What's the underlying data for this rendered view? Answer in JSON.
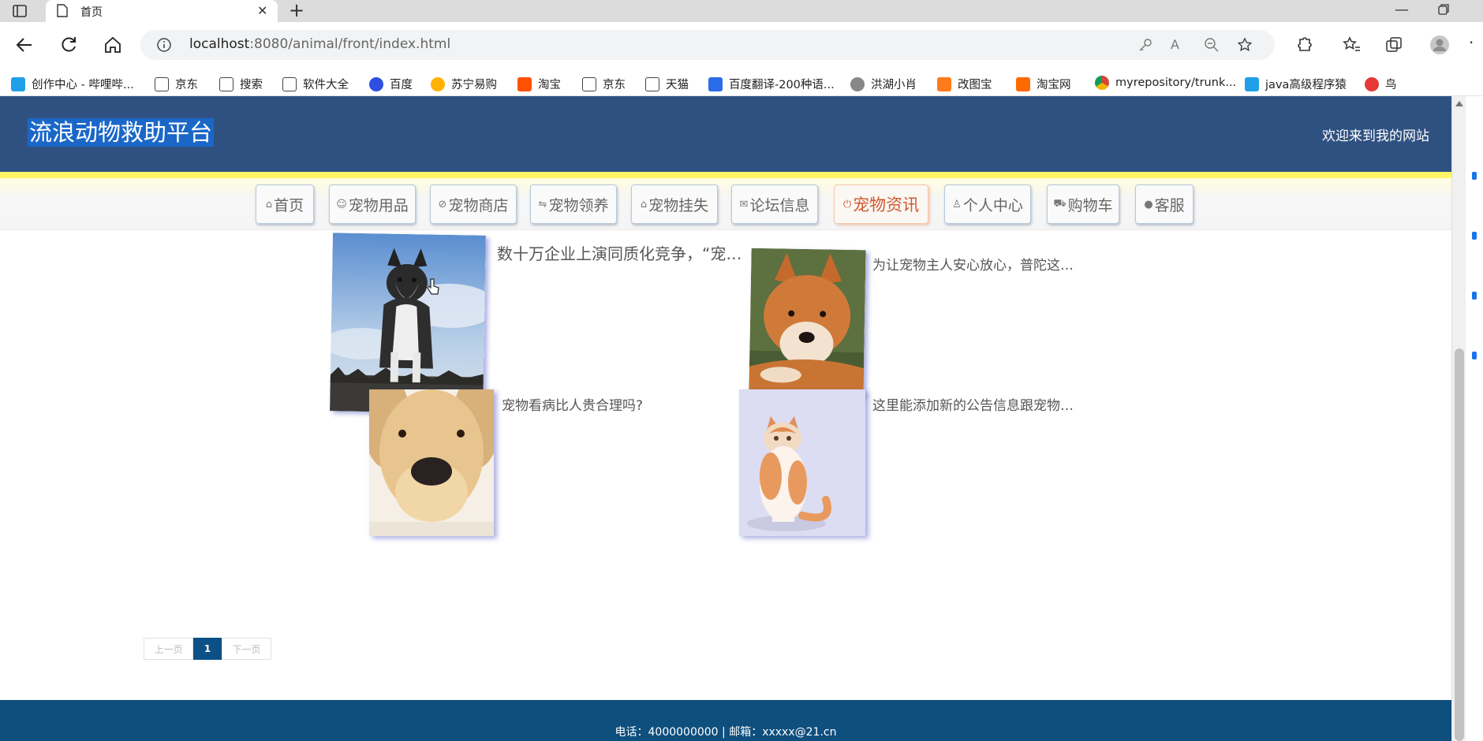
{
  "browser": {
    "tab_title": "首页",
    "url_host": "localhost",
    "url_rest": ":8080/animal/front/index.html",
    "bookmarks": [
      {
        "label": "创作中心 - 哔哩哔...",
        "color": "#21a0e8"
      },
      {
        "label": "京东",
        "color": "#ffffff"
      },
      {
        "label": "搜索",
        "color": "#ffffff"
      },
      {
        "label": "软件大全",
        "color": "#ffffff"
      },
      {
        "label": "百度",
        "color": "#2f4fe0"
      },
      {
        "label": "苏宁易购",
        "color": "#ffb300"
      },
      {
        "label": "淘宝",
        "color": "#ff5000"
      },
      {
        "label": "京东",
        "color": "#ffffff"
      },
      {
        "label": "天猫",
        "color": "#ffffff"
      },
      {
        "label": "百度翻译-200种语...",
        "color": "#2b6de8"
      },
      {
        "label": "洪湖小肖",
        "color": "#777777"
      },
      {
        "label": "改图宝",
        "color": "#ff7a1a"
      },
      {
        "label": "淘宝网",
        "color": "#ff6a00"
      },
      {
        "label": "myrepository/trunk...",
        "color": "#db4437"
      },
      {
        "label": "java高级程序猿",
        "color": "#21a0e8"
      },
      {
        "label": "鸟",
        "color": "#e53935"
      }
    ]
  },
  "site": {
    "title": "流浪动物救助平台",
    "welcome": "欢迎来到我的网站",
    "nav": [
      {
        "label": "首页",
        "icon": "⌂",
        "icon_name": "home-icon"
      },
      {
        "label": "宠物用品",
        "icon": "☺",
        "icon_name": "pet-face-icon"
      },
      {
        "label": "宠物商店",
        "icon": "⊘",
        "icon_name": "tag-icon"
      },
      {
        "label": "宠物领养",
        "icon": "⇋",
        "icon_name": "sliders-icon"
      },
      {
        "label": "宠物挂失",
        "icon": "⌂",
        "icon_name": "car-icon"
      },
      {
        "label": "论坛信息",
        "icon": "✉",
        "icon_name": "mail-icon"
      },
      {
        "label": "宠物资讯",
        "icon": "⏻",
        "icon_name": "power-icon",
        "active": true
      },
      {
        "label": "个人中心",
        "icon": "♙",
        "icon_name": "user-icon"
      },
      {
        "label": "购物车",
        "icon": "⛟",
        "icon_name": "cart-icon"
      },
      {
        "label": "客服",
        "icon": "●",
        "icon_name": "chat-icon"
      }
    ]
  },
  "news": [
    {
      "title": "数十万企业上演同质化竞争，“宠…",
      "image": "husky"
    },
    {
      "title": "为让宠物主人安心放心，普陀这…",
      "image": "shiba"
    },
    {
      "title": "宠物看病比人贵合理吗?",
      "image": "labrador"
    },
    {
      "title": "这里能添加新的公告信息跟宠物…",
      "image": "cat"
    }
  ],
  "pager": {
    "prev": "上一页",
    "current": "1",
    "next": "下一页"
  },
  "footer": {
    "text": "电话：4000000000 | 邮箱：xxxxx@21.cn"
  },
  "colors": {
    "header_bg": "#2f5181",
    "accent_yellow": "#fff366",
    "active_nav": "#d05a30",
    "footer_bg": "#0e4f7e",
    "pager_current": "#0d5085"
  }
}
